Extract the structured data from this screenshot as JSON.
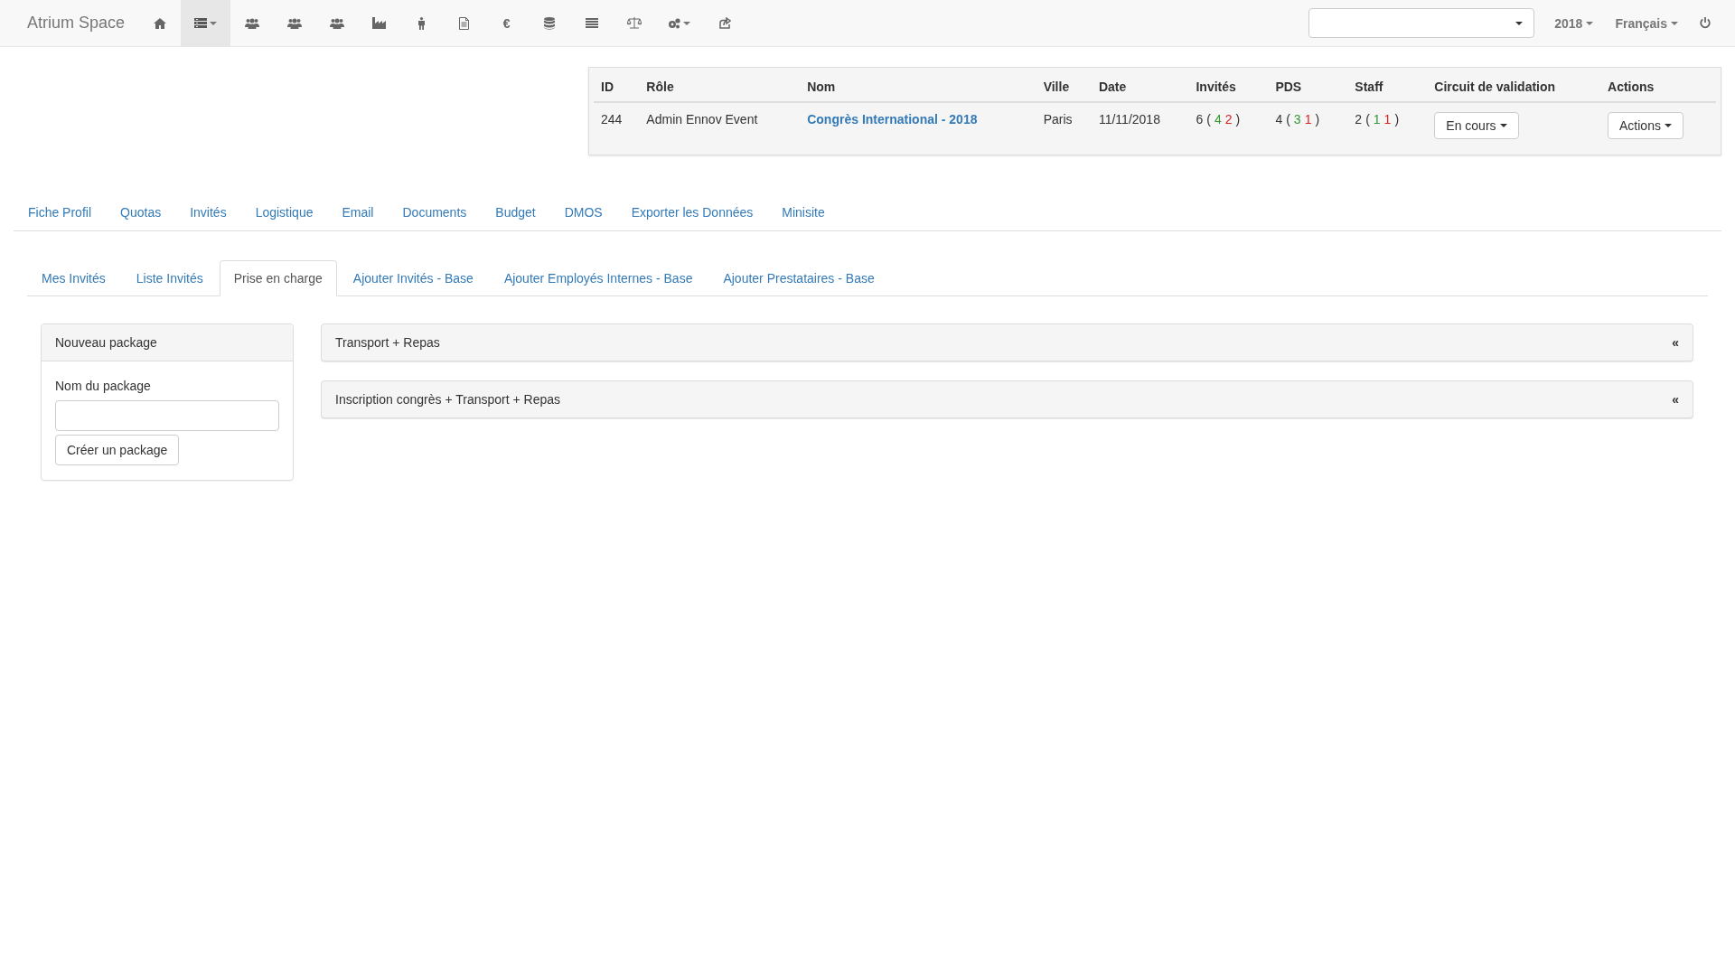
{
  "navbar": {
    "brand": "Atrium Space",
    "icons": [
      {
        "kind": "home",
        "selected": false,
        "dropdown": false
      },
      {
        "kind": "menu",
        "selected": true,
        "dropdown": true
      },
      {
        "kind": "users",
        "selected": false,
        "dropdown": false
      },
      {
        "kind": "users",
        "selected": false,
        "dropdown": false
      },
      {
        "kind": "users",
        "selected": false,
        "dropdown": false
      },
      {
        "kind": "industry",
        "selected": false,
        "dropdown": false
      },
      {
        "kind": "person",
        "selected": false,
        "dropdown": false
      },
      {
        "kind": "file",
        "selected": false,
        "dropdown": false
      },
      {
        "kind": "text",
        "label": "€",
        "selected": false,
        "dropdown": false
      },
      {
        "kind": "database",
        "selected": false,
        "dropdown": false
      },
      {
        "kind": "list",
        "selected": false,
        "dropdown": false
      },
      {
        "kind": "balance",
        "selected": false,
        "dropdown": false
      },
      {
        "kind": "cogs",
        "selected": false,
        "dropdown": true
      },
      {
        "kind": "share",
        "selected": false,
        "dropdown": false
      }
    ],
    "year": "2018",
    "language": "Français"
  },
  "event_table": {
    "columns": [
      "ID",
      "Rôle",
      "Nom",
      "Ville",
      "Date",
      "Invités",
      "PDS",
      "Staff",
      "Circuit de validation",
      "Actions"
    ],
    "rows": [
      {
        "id": "244",
        "role": "Admin Ennov Event",
        "name": "Congrès International - 2018",
        "city": "Paris",
        "date": "11/11/2018",
        "counts": [
          {
            "total": "6",
            "open": "(",
            "parts": [
              {
                "value": "4",
                "color": "#339933"
              },
              {
                "value": "2",
                "color": "#dd2222"
              }
            ],
            "close": ")"
          },
          {
            "total": "4",
            "open": "(",
            "parts": [
              {
                "value": "3",
                "color": "#339933"
              },
              {
                "value": "1",
                "color": "#dd2222"
              }
            ],
            "close": ")"
          },
          {
            "total": "2",
            "open": "(",
            "parts": [
              {
                "value": "1",
                "color": "#339933"
              },
              {
                "value": "1",
                "color": "#dd2222"
              }
            ],
            "close": ")"
          }
        ],
        "validation": "En cours",
        "actions": "Actions"
      }
    ]
  },
  "nav": [
    {
      "label": "Fiche Profil"
    },
    {
      "label": "Quotas"
    },
    {
      "label": "Invités"
    },
    {
      "label": "Logistique"
    },
    {
      "label": "Email"
    },
    {
      "label": "Documents"
    },
    {
      "label": "Budget"
    },
    {
      "label": "DMOS"
    },
    {
      "label": "Exporter les Données"
    },
    {
      "label": "Minisite"
    }
  ],
  "tabs": [
    {
      "label": "Mes Invités",
      "selected": false
    },
    {
      "label": "Liste Invités",
      "selected": false
    },
    {
      "label": "Prise en charge",
      "selected": true
    },
    {
      "label": "Ajouter Invités - Base",
      "selected": false
    },
    {
      "label": "Ajouter Employés Internes - Base",
      "selected": false
    },
    {
      "label": "Ajouter Prestataires - Base",
      "selected": false
    }
  ],
  "new_package": {
    "title": "Nouveau package",
    "field_label": "Nom du package",
    "button": "Créer un package"
  },
  "packages": [
    {
      "title": "Transport + Repas",
      "toggle": "«"
    },
    {
      "title": "Inscription congrès + Transport + Repas",
      "toggle": "«"
    }
  ]
}
